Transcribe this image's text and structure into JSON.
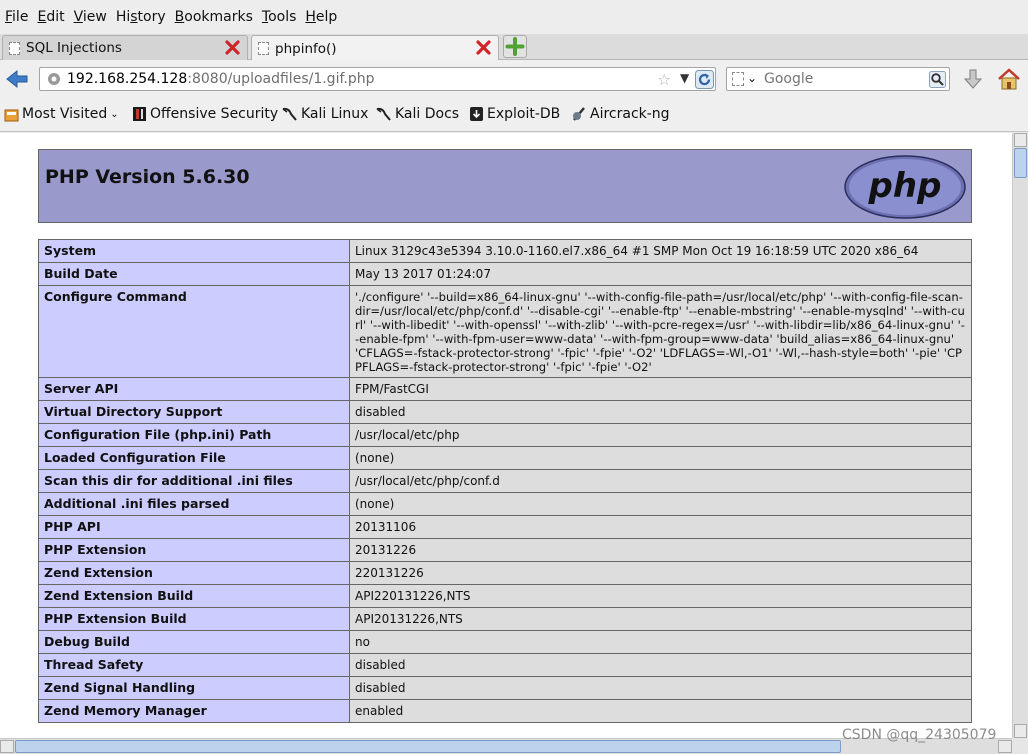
{
  "menu": [
    "File",
    "Edit",
    "View",
    "History",
    "Bookmarks",
    "Tools",
    "Help"
  ],
  "menu_access": [
    "F",
    "E",
    "V",
    "s",
    "B",
    "T",
    "H"
  ],
  "tabs": [
    {
      "label": "SQL Injections",
      "active": false
    },
    {
      "label": "phpinfo()",
      "active": true
    }
  ],
  "url": {
    "host": "192.168.254.128",
    "rest": ":8080/uploadfiles/1.gif.php"
  },
  "search": {
    "placeholder": "Google"
  },
  "bookmarks": [
    "Most Visited",
    "Offensive Security",
    "Kali Linux",
    "Kali Docs",
    "Exploit-DB",
    "Aircrack-ng"
  ],
  "page": {
    "title": "PHP Version 5.6.30",
    "logo_text": "php",
    "rows": [
      {
        "key": "System",
        "value": "Linux 3129c43e5394 3.10.0-1160.el7.x86_64 #1 SMP Mon Oct 19 16:18:59 UTC 2020 x86_64"
      },
      {
        "key": "Build Date",
        "value": "May 13 2017 01:24:07"
      },
      {
        "key": "Configure Command",
        "value": "'./configure' '--build=x86_64-linux-gnu' '--with-config-file-path=/usr/local/etc/php' '--with-config-file-scan-dir=/usr/local/etc/php/conf.d' '--disable-cgi' '--enable-ftp' '--enable-mbstring' '--enable-mysqlnd' '--with-curl' '--with-libedit' '--with-openssl' '--with-zlib' '--with-pcre-regex=/usr' '--with-libdir=lib/x86_64-linux-gnu' '--enable-fpm' '--with-fpm-user=www-data' '--with-fpm-group=www-data' 'build_alias=x86_64-linux-gnu' 'CFLAGS=-fstack-protector-strong' '-fpic' '-fpie' '-O2' 'LDFLAGS=-Wl,-O1' '-Wl,--hash-style=both' '-pie' 'CPPFLAGS=-fstack-protector-strong' '-fpic' '-fpie' '-O2'"
      },
      {
        "key": "Server API",
        "value": "FPM/FastCGI"
      },
      {
        "key": "Virtual Directory Support",
        "value": "disabled"
      },
      {
        "key": "Configuration File (php.ini) Path",
        "value": "/usr/local/etc/php"
      },
      {
        "key": "Loaded Configuration File",
        "value": "(none)"
      },
      {
        "key": "Scan this dir for additional .ini files",
        "value": "/usr/local/etc/php/conf.d"
      },
      {
        "key": "Additional .ini files parsed",
        "value": "(none)"
      },
      {
        "key": "PHP API",
        "value": "20131106"
      },
      {
        "key": "PHP Extension",
        "value": "20131226"
      },
      {
        "key": "Zend Extension",
        "value": "220131226"
      },
      {
        "key": "Zend Extension Build",
        "value": "API220131226,NTS"
      },
      {
        "key": "PHP Extension Build",
        "value": "API20131226,NTS"
      },
      {
        "key": "Debug Build",
        "value": "no"
      },
      {
        "key": "Thread Safety",
        "value": "disabled"
      },
      {
        "key": "Zend Signal Handling",
        "value": "disabled"
      },
      {
        "key": "Zend Memory Manager",
        "value": "enabled"
      }
    ]
  },
  "watermark": "CSDN @qq_24305079",
  "colors": {
    "php_header": "#9999cc",
    "key_cell": "#ccccff",
    "value_cell": "#dddddd"
  }
}
